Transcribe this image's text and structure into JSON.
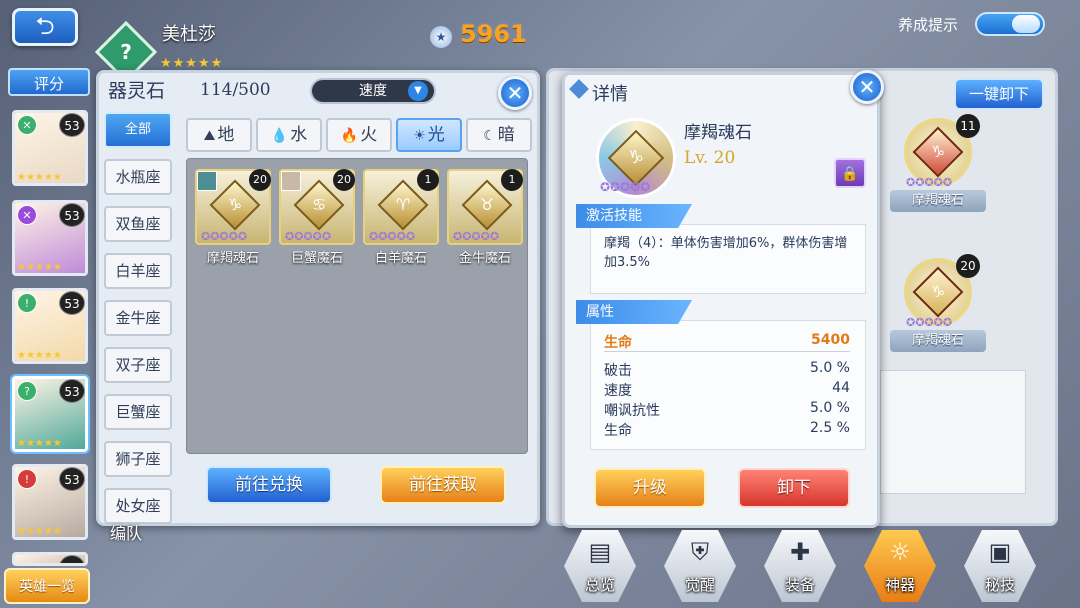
{
  "top": {
    "back_icon": "back-arrow-icon",
    "hero_name": "美杜莎",
    "hero_element": "?",
    "hero_stars": "★★★★★",
    "power": "5961",
    "tip_label": "养成提示"
  },
  "left": {
    "eval_label": "评分",
    "heroes": [
      {
        "level": "53",
        "elem": "✕",
        "elem_color": "#3bb06c",
        "bg": "#e8d9c4",
        "stars": "★★★★★"
      },
      {
        "level": "53",
        "elem": "✕",
        "elem_color": "#9a4bd9",
        "bg": "#c08ad8",
        "stars": "★★★★★"
      },
      {
        "level": "53",
        "elem": "!",
        "elem_color": "#3bb06c",
        "bg": "#f2d9a8",
        "stars": "★★★★★"
      },
      {
        "level": "53",
        "elem": "?",
        "elem_color": "#3bb06c",
        "bg": "#4fa99a",
        "stars": "★★★★★"
      },
      {
        "level": "53",
        "elem": "!",
        "elem_color": "#d63a3a",
        "bg": "#b7a9a0",
        "stars": "★★★★★"
      },
      {
        "level": "53",
        "elem": "",
        "elem_color": "#3bb06c",
        "bg": "#d7c1b0",
        "stars": ""
      }
    ],
    "hero_list_label": "英雄一览"
  },
  "stone_panel": {
    "title": "器灵石",
    "count": "114/500",
    "sort_value": "速度",
    "zodiacs": [
      "全部",
      "水瓶座",
      "双鱼座",
      "白羊座",
      "金牛座",
      "双子座",
      "巨蟹座",
      "狮子座",
      "处女座"
    ],
    "element_tabs": [
      {
        "icon": "⛰",
        "label": "地"
      },
      {
        "icon": "💧",
        "label": "水"
      },
      {
        "icon": "🔥",
        "label": "火"
      },
      {
        "icon": "☀",
        "label": "光"
      },
      {
        "icon": "☾",
        "label": "暗"
      }
    ],
    "stones": [
      {
        "name": "摩羯魂石",
        "level": "20",
        "glyph": "♑",
        "stars": "✪✪✪✪✪"
      },
      {
        "name": "巨蟹魔石",
        "level": "20",
        "glyph": "♋",
        "stars": "✪✪✪✪✪"
      },
      {
        "name": "白羊魔石",
        "level": "1",
        "glyph": "♈",
        "stars": "✪✪✪✪✪"
      },
      {
        "name": "金牛魔石",
        "level": "1",
        "glyph": "♉",
        "stars": "✪✪✪✪✪"
      }
    ],
    "exchange_label": "前往兑换",
    "obtain_label": "前往获取"
  },
  "detail": {
    "title": "详情",
    "stone_name": "摩羯魂石",
    "level": "Lv. 20",
    "glyph": "♑",
    "stars": "✪✪✪✪✪",
    "skill_header": "激活技能",
    "skill_text": "摩羯（4）：单体伤害增加6%，群体伤害增加3.5%",
    "attr_header": "属性",
    "main_attr": {
      "name": "生命",
      "value": "5400"
    },
    "attrs": [
      {
        "name": "破击",
        "value": "5.0 %"
      },
      {
        "name": "速度",
        "value": "44"
      },
      {
        "name": "嘲讽抗性",
        "value": "5.0 %"
      },
      {
        "name": "生命",
        "value": "2.5 %"
      }
    ],
    "upgrade_label": "升级",
    "unequip_label": "卸下"
  },
  "right": {
    "unload_all": "一键卸下",
    "equipped": [
      {
        "name": "摩羯魂石",
        "level": "11",
        "glyph": "♑",
        "color": "#d04a3a",
        "stars": "✪✪✪✪✪"
      },
      {
        "name": "摩羯魂石",
        "level": "20",
        "glyph": "♑",
        "color": "#d4b35a",
        "stars": "✪✪✪✪✪"
      }
    ]
  },
  "nav": [
    {
      "label": "总览",
      "icon": "▤"
    },
    {
      "label": "觉醒",
      "icon": "⛨"
    },
    {
      "label": "装备",
      "icon": "✚"
    },
    {
      "label": "神器",
      "icon": "☼"
    },
    {
      "label": "秘技",
      "icon": "▣"
    }
  ],
  "formation_label": "编队"
}
